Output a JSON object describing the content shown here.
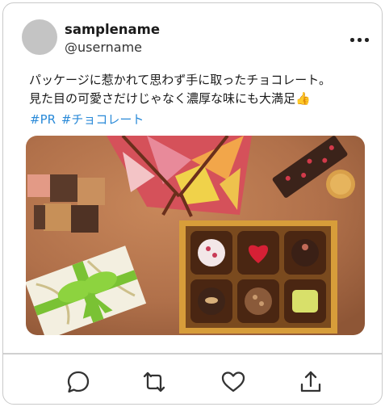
{
  "post": {
    "display_name": "samplename",
    "handle": "@username",
    "text_lines": [
      "パッケージに惹かれて思わず手に取ったチョコレート。",
      "見た目の可愛さだけじゃなく濃厚な味にも大満足👍"
    ],
    "hashtags": [
      "#PR",
      "#チョコレート"
    ],
    "image_alt": "Assorted chocolates on a brown background",
    "link_color": "#2a8ad8"
  },
  "actions": [
    {
      "name": "reply",
      "icon": "comment-icon"
    },
    {
      "name": "repost",
      "icon": "repost-icon"
    },
    {
      "name": "like",
      "icon": "heart-icon"
    },
    {
      "name": "share",
      "icon": "share-icon"
    }
  ]
}
